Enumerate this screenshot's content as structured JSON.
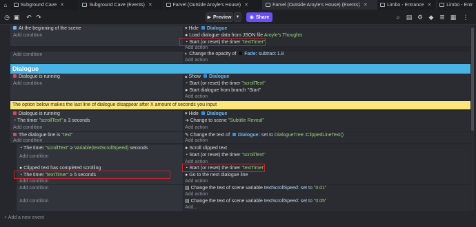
{
  "tabs": [
    {
      "label": "Subground Cave",
      "close": "✕"
    },
    {
      "label": "Subground Cave (Events)",
      "close": "✕"
    },
    {
      "label": "Farvel (Outside Aroyle's House)",
      "close": "✕"
    },
    {
      "label": "Farvel (Outside Aroyle's House) (Events)",
      "close": "✕"
    },
    {
      "label": "Limbo - Entrance",
      "close": "✕"
    },
    {
      "label": "Limbo - Entr",
      "close": ""
    }
  ],
  "toolbar": {
    "preview_label": "Preview",
    "share_label": "Share",
    "icons": [
      "clock-icon",
      "project-icon",
      "undo-icon",
      "redo-icon",
      "search-icon",
      "scene-icon",
      "settings-icon",
      "objects-icon",
      "layers-icon",
      "properties-icon",
      "more-icon"
    ]
  },
  "events": {
    "e1": {
      "cond": "At the beginning of the scene",
      "add_condition": "Add condition",
      "act_hide": "Hide",
      "act_hide_obj": "Dialogue",
      "act_load": "Load dialogue data from JSON file",
      "act_load_file": "Aroyle's Thoughts",
      "act_start": "Start (or reset) the timer",
      "act_start_timer": "\"textTimer\"",
      "add_action": "Add action"
    },
    "e2": {
      "add_condition": "Add condition",
      "act_opacity": "Change the opacity of",
      "act_opacity_obj": "Fade:",
      "act_opacity_val": "subtract  1.8",
      "add_action": "Add action"
    },
    "group": "Dialogue",
    "e3": {
      "cond": "Dialogue is running",
      "add_condition": "Add condition",
      "act_show": "Show",
      "act_show_obj": "Dialogue",
      "act_start": "Start (or reset) the timer",
      "act_start_timer": "\"scrollText\"",
      "act_branch": "Start dialogue from branch \"Start\"",
      "add_action": "Add action"
    },
    "comment": "The option below makes the last line of dialogue disappear after X amount of seconds you input",
    "e4": {
      "cond1": "Dialogue is running",
      "cond2_pre": "The timer",
      "cond2_timer": "\"scrollText\"",
      "cond2_post": "≥  3 seconds",
      "add_condition": "Add condition",
      "act_hide": "Hide",
      "act_hide_obj": "Dialogue",
      "act_scene": "Change to scene",
      "act_scene_name": "\"Subtitle Reveal\"",
      "add_action": "Add action"
    },
    "e5": {
      "cond_pre": "The dialogue line is",
      "cond_val": "\"text\"",
      "add_condition": "Add condition",
      "act_text_pre": "Change the text of",
      "act_text_obj": "Dialogue:",
      "act_text_set": "set to",
      "act_text_val": "DialogueTree::ClippedLineText()",
      "add_action": "Add action"
    },
    "e6": {
      "cond_pre": "The timer",
      "cond_timer": "\"scrollText\"",
      "cond_op": "≥",
      "cond_var": "Variable(textScrollSpeed)",
      "cond_post": "seconds",
      "add_condition": "Add condition",
      "act_scroll": "Scroll clipped text",
      "act_start": "Start (or reset) the timer",
      "act_start_timer": "\"scrollText\"",
      "add_action": "Add action"
    },
    "e7": {
      "cond1": "Clipped text has completed scrolling",
      "cond2_pre": "The timer",
      "cond2_timer": "\"textTimer\"",
      "cond2_post": "≥  5 seconds",
      "add_condition": "Add condition",
      "act_start": "Start (or reset) the timer",
      "act_start_timer": "\"textTimer\"",
      "act_next": "Go to the next dialogue line",
      "add_action": "Add action"
    },
    "e8": {
      "add_condition": "Add condition",
      "act_pre": "Change the text of scene variable",
      "act_var": "textScrollSpeed:",
      "act_set": "set to",
      "act_val": "\"0.01\"",
      "add_action": "Add action"
    },
    "e9": {
      "add_condition": "Add condition",
      "act_pre": "Change the text of scene variable",
      "act_var": "textScrollSpeed:",
      "act_set": "set to",
      "act_val": "\"0.05\"",
      "add_action": "Add..."
    },
    "add_event": "Add a new event"
  }
}
